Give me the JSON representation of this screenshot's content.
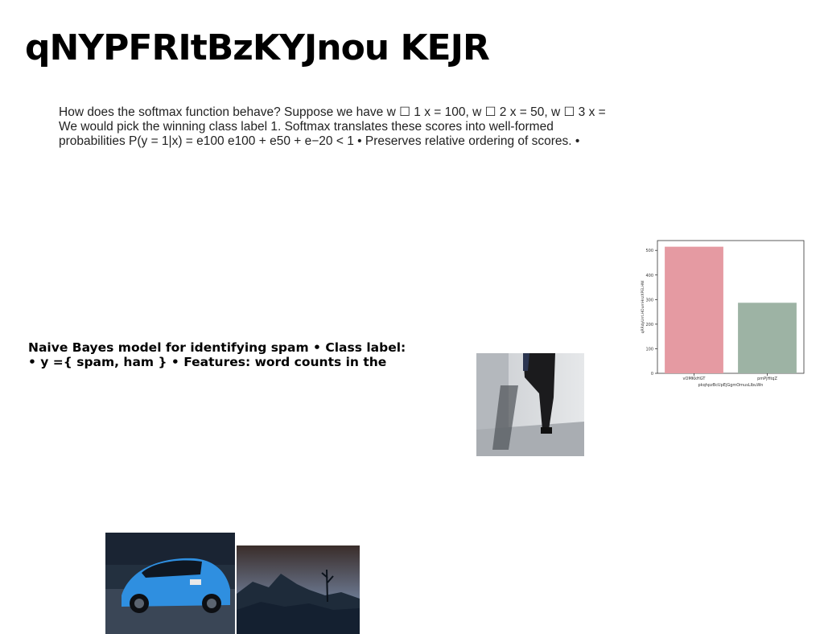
{
  "slide": {
    "title": "qNYPFRItBzKYJnou KEJR",
    "paragraph_lines": [
      "How does the softmax function behave? Suppose we have w ☐ 1 x = 100, w ☐ 2 x = 50, w ☐ 3 x =",
      "We would pick the winning class label 1. Softmax translates these scores into well-formed",
      "probabilities P(y = 1|x) = e100 e100 + e50 + e−20 < 1 • Preserves relative ordering of scores. •"
    ],
    "bold_lines": [
      "Naive Bayes model for identifying spam • Class label:",
      "• y ={ spam, ham } • Features: word counts in the"
    ]
  },
  "chart_data": {
    "type": "bar",
    "categories": [
      "vOMKkHGT",
      "pmPjHtqZ"
    ],
    "values": [
      515,
      287
    ],
    "colors": [
      "#e59aa2",
      "#9db3a4"
    ],
    "xlabel": "pkqhpzBcUpEjGgmOmusLlbuWn",
    "ylabel": "qRRdyUrrLHOumHnzXPELHW",
    "ylim": [
      0,
      540
    ],
    "yticks": [
      0,
      100,
      200,
      300,
      400,
      500
    ],
    "grid": false,
    "legend": "none"
  }
}
